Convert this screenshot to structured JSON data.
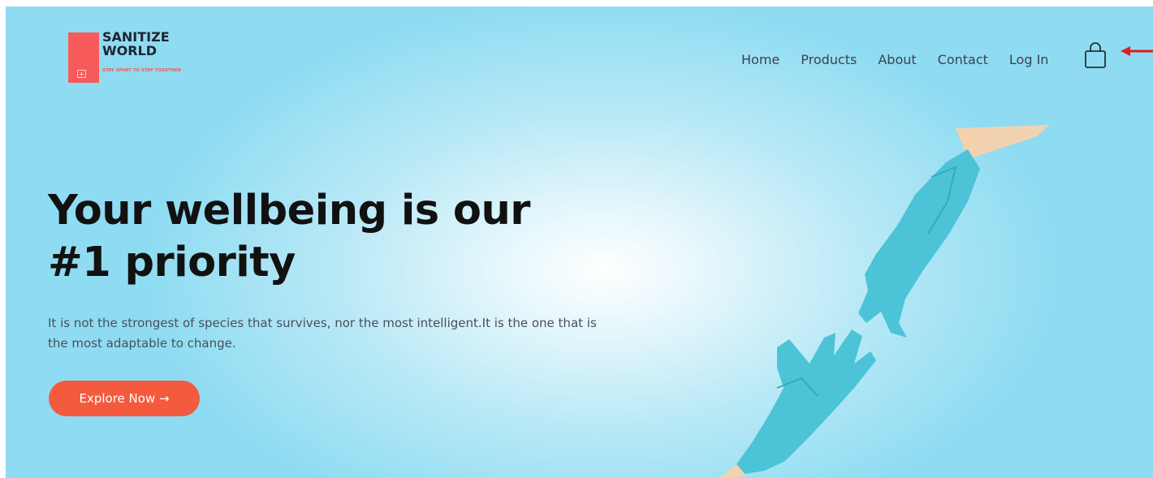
{
  "logo": {
    "title": "SANITIZE WORLD",
    "tagline": "STAY APART TO STAY TOGETHER"
  },
  "nav": {
    "items": [
      "Home",
      "Products",
      "About",
      "Contact",
      "Log In"
    ]
  },
  "cart": {
    "icon": "shopping-bag-icon"
  },
  "hero": {
    "heading_line1": "Your wellbeing is our",
    "heading_line2": "#1 priority",
    "subtitle": "It is not the strongest of species that survives, nor the most intelligent.It is the one that is the most adaptable to change.",
    "button_label": "Explore Now →"
  },
  "colors": {
    "accent": "#f45a3e",
    "logo_block": "#f65a5a",
    "background": "#8fdcf2",
    "glove": "#4cc3d6"
  }
}
